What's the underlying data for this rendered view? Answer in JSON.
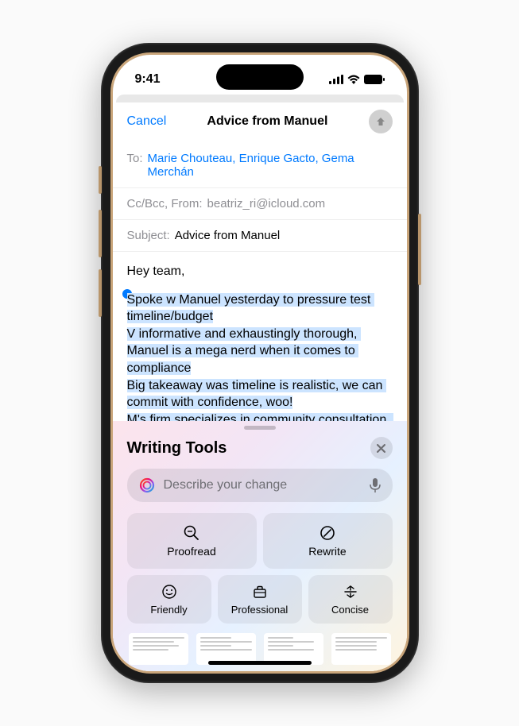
{
  "status_bar": {
    "time": "9:41"
  },
  "compose": {
    "cancel_label": "Cancel",
    "title": "Advice from Manuel",
    "to_label": "To:",
    "recipients": "Marie Chouteau, Enrique Gacto, Gema Merchán",
    "ccbcc_label": "Cc/Bcc, From:",
    "from_email": "beatriz_ri@icloud.com",
    "subject_label": "Subject:",
    "subject_value": "Advice from Manuel",
    "body_greeting": "Hey team,",
    "body_selected": "Spoke w Manuel yesterday to pressure test timeline/budget\nV informative and exhaustingly thorough, Manuel is a mega nerd when it comes to compliance\nBig takeaway was timeline is realistic, we can commit with confidence, woo!\nM's firm specializes in community consultation, we need help here, should consider engaging"
  },
  "writing_tools": {
    "title": "Writing Tools",
    "placeholder": "Describe your change",
    "buttons": {
      "proofread": "Proofread",
      "rewrite": "Rewrite",
      "friendly": "Friendly",
      "professional": "Professional",
      "concise": "Concise"
    }
  }
}
